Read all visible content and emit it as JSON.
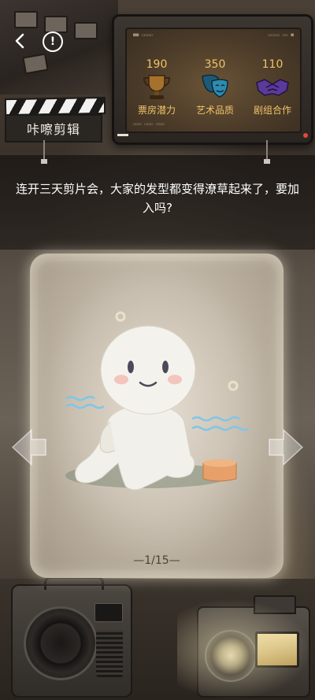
{
  "header": {
    "back_icon": "chevron-left-icon",
    "info_icon": "exclamation-circle-icon",
    "info_glyph": "!",
    "title": "咔嚓剪辑"
  },
  "stats": [
    {
      "value": "190",
      "label": "票房潜力",
      "icon": "trophy-icon",
      "color": "#a4722c"
    },
    {
      "value": "350",
      "label": "艺术品质",
      "icon": "mask-icon",
      "color": "#2e8bb0"
    },
    {
      "value": "110",
      "label": "剧组合作",
      "icon": "handshake-icon",
      "color": "#5a3a9a"
    }
  ],
  "question": "连开三天剪片会，大家的发型都变得潦草起来了，要加入吗?",
  "card": {
    "page_indicator": "—1/15—",
    "left_arrow_icon": "arrow-left-icon",
    "right_arrow_icon": "arrow-right-icon"
  },
  "colors": {
    "accent": "#f0c36a",
    "text_light": "#ffffff",
    "card_bg": "#d0c6b6"
  }
}
